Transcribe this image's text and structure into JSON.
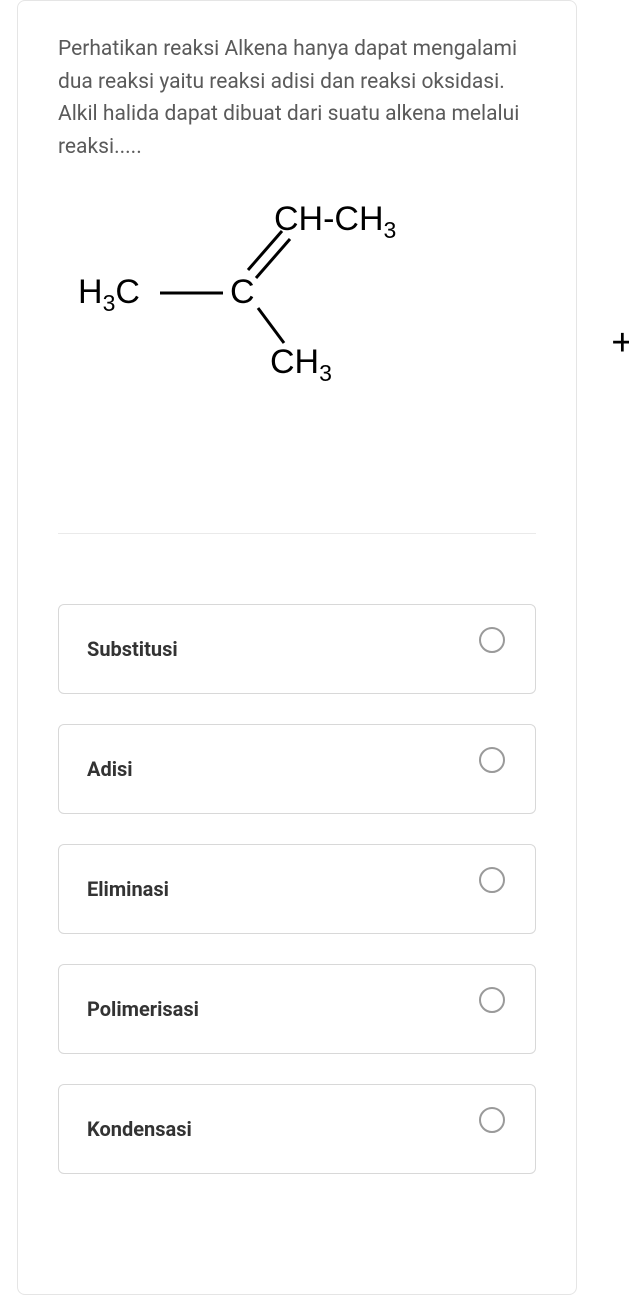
{
  "question": "Perhatikan reaksi Alkena hanya dapat mengalami dua reaksi yaitu reaksi adisi dan reaksi oksidasi. Alkil halida dapat dibuat dari suatu alkena melalui reaksi.....",
  "chemical": {
    "left": "H₃C",
    "center": "C",
    "top_right": "CH-CH₃",
    "bottom_right": "CH₃"
  },
  "plus_fragment": "+",
  "options": [
    {
      "label": "Substitusi"
    },
    {
      "label": "Adisi"
    },
    {
      "label": "Eliminasi"
    },
    {
      "label": "Polimerisasi"
    },
    {
      "label": "Kondensasi"
    }
  ]
}
